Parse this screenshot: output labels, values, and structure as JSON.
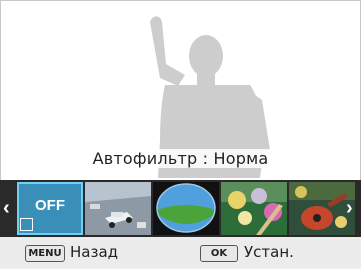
{
  "preview": {
    "filter_label": "Автофильтр : Норма"
  },
  "filter_strip": {
    "selected": "OFF",
    "items": [
      {
        "label": "OFF",
        "icon": "off-icon"
      },
      {
        "icon": "miniature-car-thumbnail"
      },
      {
        "icon": "fisheye-field-thumbnail"
      },
      {
        "icon": "flowers-painting-thumbnail"
      },
      {
        "icon": "guitar-painting-thumbnail"
      }
    ]
  },
  "bottom_bar": {
    "menu_key": "MENU",
    "menu_label": "Назад",
    "ok_key": "OK",
    "ok_label": "Устан."
  },
  "colors": {
    "selection_outline": "#6fd0f5",
    "strip_background": "#2a2a2a",
    "bottom_bar_background": "#ececec"
  }
}
